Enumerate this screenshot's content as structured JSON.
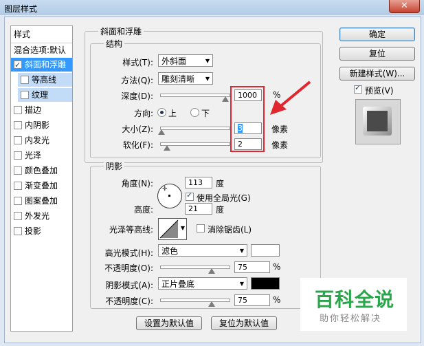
{
  "window": {
    "title": "图层样式",
    "close_glyph": "✕"
  },
  "styles_list": {
    "header": "样式",
    "blend_options": "混合选项:默认",
    "items": [
      {
        "label": "斜面和浮雕",
        "checked": true,
        "selected": true
      },
      {
        "label": "等高线",
        "checked": false,
        "sub": true
      },
      {
        "label": "纹理",
        "checked": false,
        "sub": true
      },
      {
        "label": "描边",
        "checked": false
      },
      {
        "label": "内阴影",
        "checked": false
      },
      {
        "label": "内发光",
        "checked": false
      },
      {
        "label": "光泽",
        "checked": false
      },
      {
        "label": "颜色叠加",
        "checked": false
      },
      {
        "label": "渐变叠加",
        "checked": false
      },
      {
        "label": "图案叠加",
        "checked": false
      },
      {
        "label": "外发光",
        "checked": false
      },
      {
        "label": "投影",
        "checked": false
      }
    ]
  },
  "bevel": {
    "title": "斜面和浮雕",
    "structure": {
      "title": "结构",
      "style_label": "样式(T):",
      "style_value": "外斜面",
      "technique_label": "方法(Q):",
      "technique_value": "雕刻清晰",
      "depth_label": "深度(D):",
      "depth_value": "1000",
      "depth_unit": "%",
      "depth_fraction": 0.95,
      "direction_label": "方向:",
      "dir_up": "上",
      "dir_down": "下",
      "direction_selected": "上",
      "size_label": "大小(Z):",
      "size_value": "3",
      "size_unit": "像素",
      "size_fraction": 0.02,
      "soften_label": "软化(F):",
      "soften_value": "2",
      "soften_unit": "像素",
      "soften_fraction": 0.1
    },
    "shading": {
      "title": "阴影",
      "angle_label": "角度(N):",
      "angle_value": "113",
      "angle_unit": "度",
      "global_light_label": "使用全局光(G)",
      "global_light_checked": true,
      "altitude_label": "高度:",
      "altitude_value": "21",
      "altitude_unit": "度",
      "gloss_label": "光泽等高线:",
      "antialias_label": "消除锯齿(L)",
      "antialias_checked": false,
      "highlight_mode_label": "高光模式(H):",
      "highlight_mode_value": "滤色",
      "highlight_color": "#ffffff",
      "highlight_opacity_label": "不透明度(O):",
      "highlight_opacity_value": "75",
      "highlight_opacity_unit": "%",
      "highlight_opacity_fraction": 0.75,
      "shadow_mode_label": "阴影模式(A):",
      "shadow_mode_value": "正片叠底",
      "shadow_color": "#000000",
      "shadow_opacity_label": "不透明度(C):",
      "shadow_opacity_value": "75",
      "shadow_opacity_unit": "%",
      "shadow_opacity_fraction": 0.75
    },
    "make_default": "设置为默认值",
    "reset_default": "复位为默认值"
  },
  "buttons": {
    "ok": "确定",
    "reset": "复位",
    "new_style": "新建样式(W)...",
    "preview_label": "预览(V)",
    "preview_checked": true
  },
  "watermark": {
    "line1": "百科全说",
    "line2": "助你轻松解决"
  }
}
